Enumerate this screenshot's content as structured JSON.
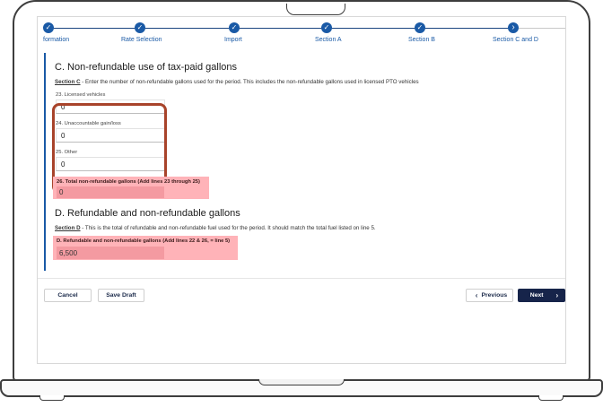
{
  "stepper": {
    "steps": [
      {
        "label": "Information",
        "display": "formation",
        "state": "complete"
      },
      {
        "label": "Rate Selection",
        "state": "complete"
      },
      {
        "label": "Import",
        "state": "complete"
      },
      {
        "label": "Section A",
        "state": "complete"
      },
      {
        "label": "Section B",
        "state": "complete"
      },
      {
        "label": "Section C and D",
        "state": "current"
      }
    ],
    "check_glyph": "✓",
    "current_glyph": "›"
  },
  "section_c": {
    "title": "C. Non-refundable use of tax-paid gallons",
    "desc_bold": "Section C",
    "desc_text": " - Enter the number of non-refundable gallons used for the period. This includes the non-refundable gallons used in licensed PTO vehicles",
    "fields": [
      {
        "label": "23. Licensed vehicles",
        "value": "0"
      },
      {
        "label": "24. Unaccountable gain/loss",
        "value": "0"
      },
      {
        "label": "25. Other",
        "value": "0"
      }
    ],
    "total": {
      "label": "26. Total non-refundable gallons (Add lines 23 through 25)",
      "value": "0"
    }
  },
  "section_d": {
    "title": "D. Refundable and non-refundable gallons",
    "desc_bold": "Section D",
    "desc_text": " - This is the total of refundable and non-refundable fuel used for the period. It should match the total fuel listed on line 5.",
    "total": {
      "label": "D. Refundable and non-refundable gallons (Add lines 22 & 26, = line 5)",
      "value": "6,500"
    }
  },
  "footer": {
    "cancel_label": "Cancel",
    "save_draft_label": "Save Draft",
    "previous_label": "Previous",
    "next_label": "Next",
    "prev_icon": "‹",
    "next_icon": "›"
  },
  "colors": {
    "accent": "#1a5aa6",
    "highlight": "#ffb3b8",
    "callout": "#a8432a",
    "primary_button": "#16244a"
  }
}
